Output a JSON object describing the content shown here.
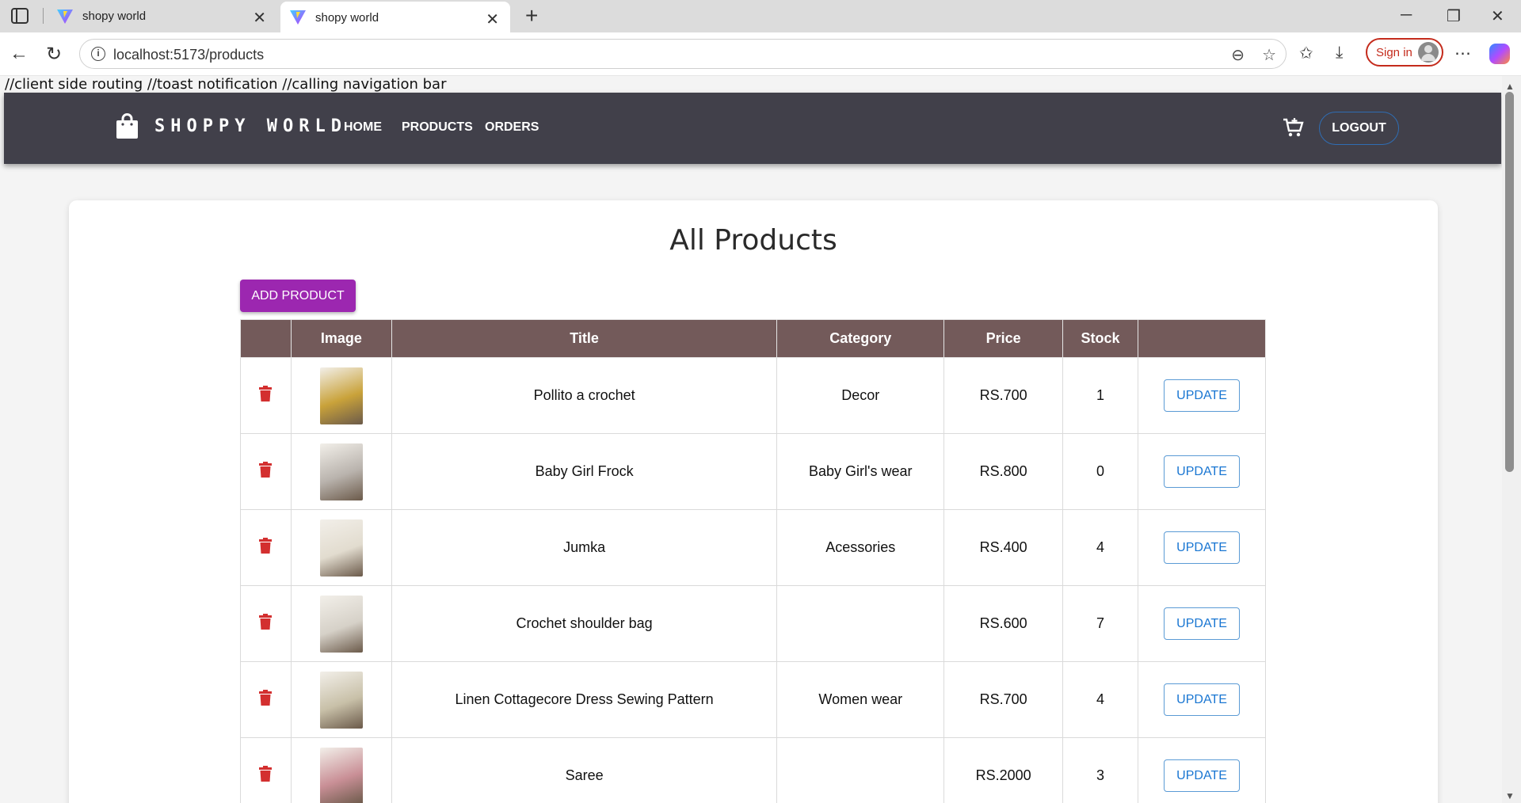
{
  "browser": {
    "tabs": [
      {
        "title": "shopy world",
        "active": false
      },
      {
        "title": "shopy world",
        "active": true
      }
    ],
    "url": "localhost:5173/products",
    "signin_label": "Sign in"
  },
  "dev_note": "//client side routing //toast notification //calling navigation bar",
  "navbar": {
    "brand": "SHOPPY WORLD",
    "links": [
      "HOME",
      "PRODUCTS",
      "ORDERS"
    ],
    "logout_label": "LOGOUT"
  },
  "page": {
    "title": "All Products",
    "add_button_label": "ADD PRODUCT"
  },
  "table": {
    "columns": [
      "",
      "Image",
      "Title",
      "Category",
      "Price",
      "Stock",
      ""
    ],
    "rows": [
      {
        "title": "Pollito a crochet",
        "category": "Decor",
        "price": "RS.700",
        "stock": "1",
        "action": "UPDATE",
        "thumb_color": "#c9a23a"
      },
      {
        "title": "Baby Girl Frock",
        "category": "Baby Girl's wear",
        "price": "RS.800",
        "stock": "0",
        "action": "UPDATE",
        "thumb_color": "#b9b3ad"
      },
      {
        "title": "Jumka",
        "category": "Acessories",
        "price": "RS.400",
        "stock": "4",
        "action": "UPDATE",
        "thumb_color": "#e2dccf"
      },
      {
        "title": "Crochet shoulder bag",
        "category": "",
        "price": "RS.600",
        "stock": "7",
        "action": "UPDATE",
        "thumb_color": "#d6d1c8"
      },
      {
        "title": "Linen Cottagecore Dress Sewing Pattern",
        "category": "Women wear",
        "price": "RS.700",
        "stock": "4",
        "action": "UPDATE",
        "thumb_color": "#c8c0a8"
      },
      {
        "title": "Saree",
        "category": "",
        "price": "RS.2000",
        "stock": "3",
        "action": "UPDATE",
        "thumb_color": "#c98f96"
      }
    ]
  },
  "colors": {
    "appbar": "#41404a",
    "table_header": "#735a5a",
    "add_button": "#9c27b0",
    "price": "#d4a017",
    "delete_icon": "#d32f2f",
    "update_button": "#1976d2"
  }
}
